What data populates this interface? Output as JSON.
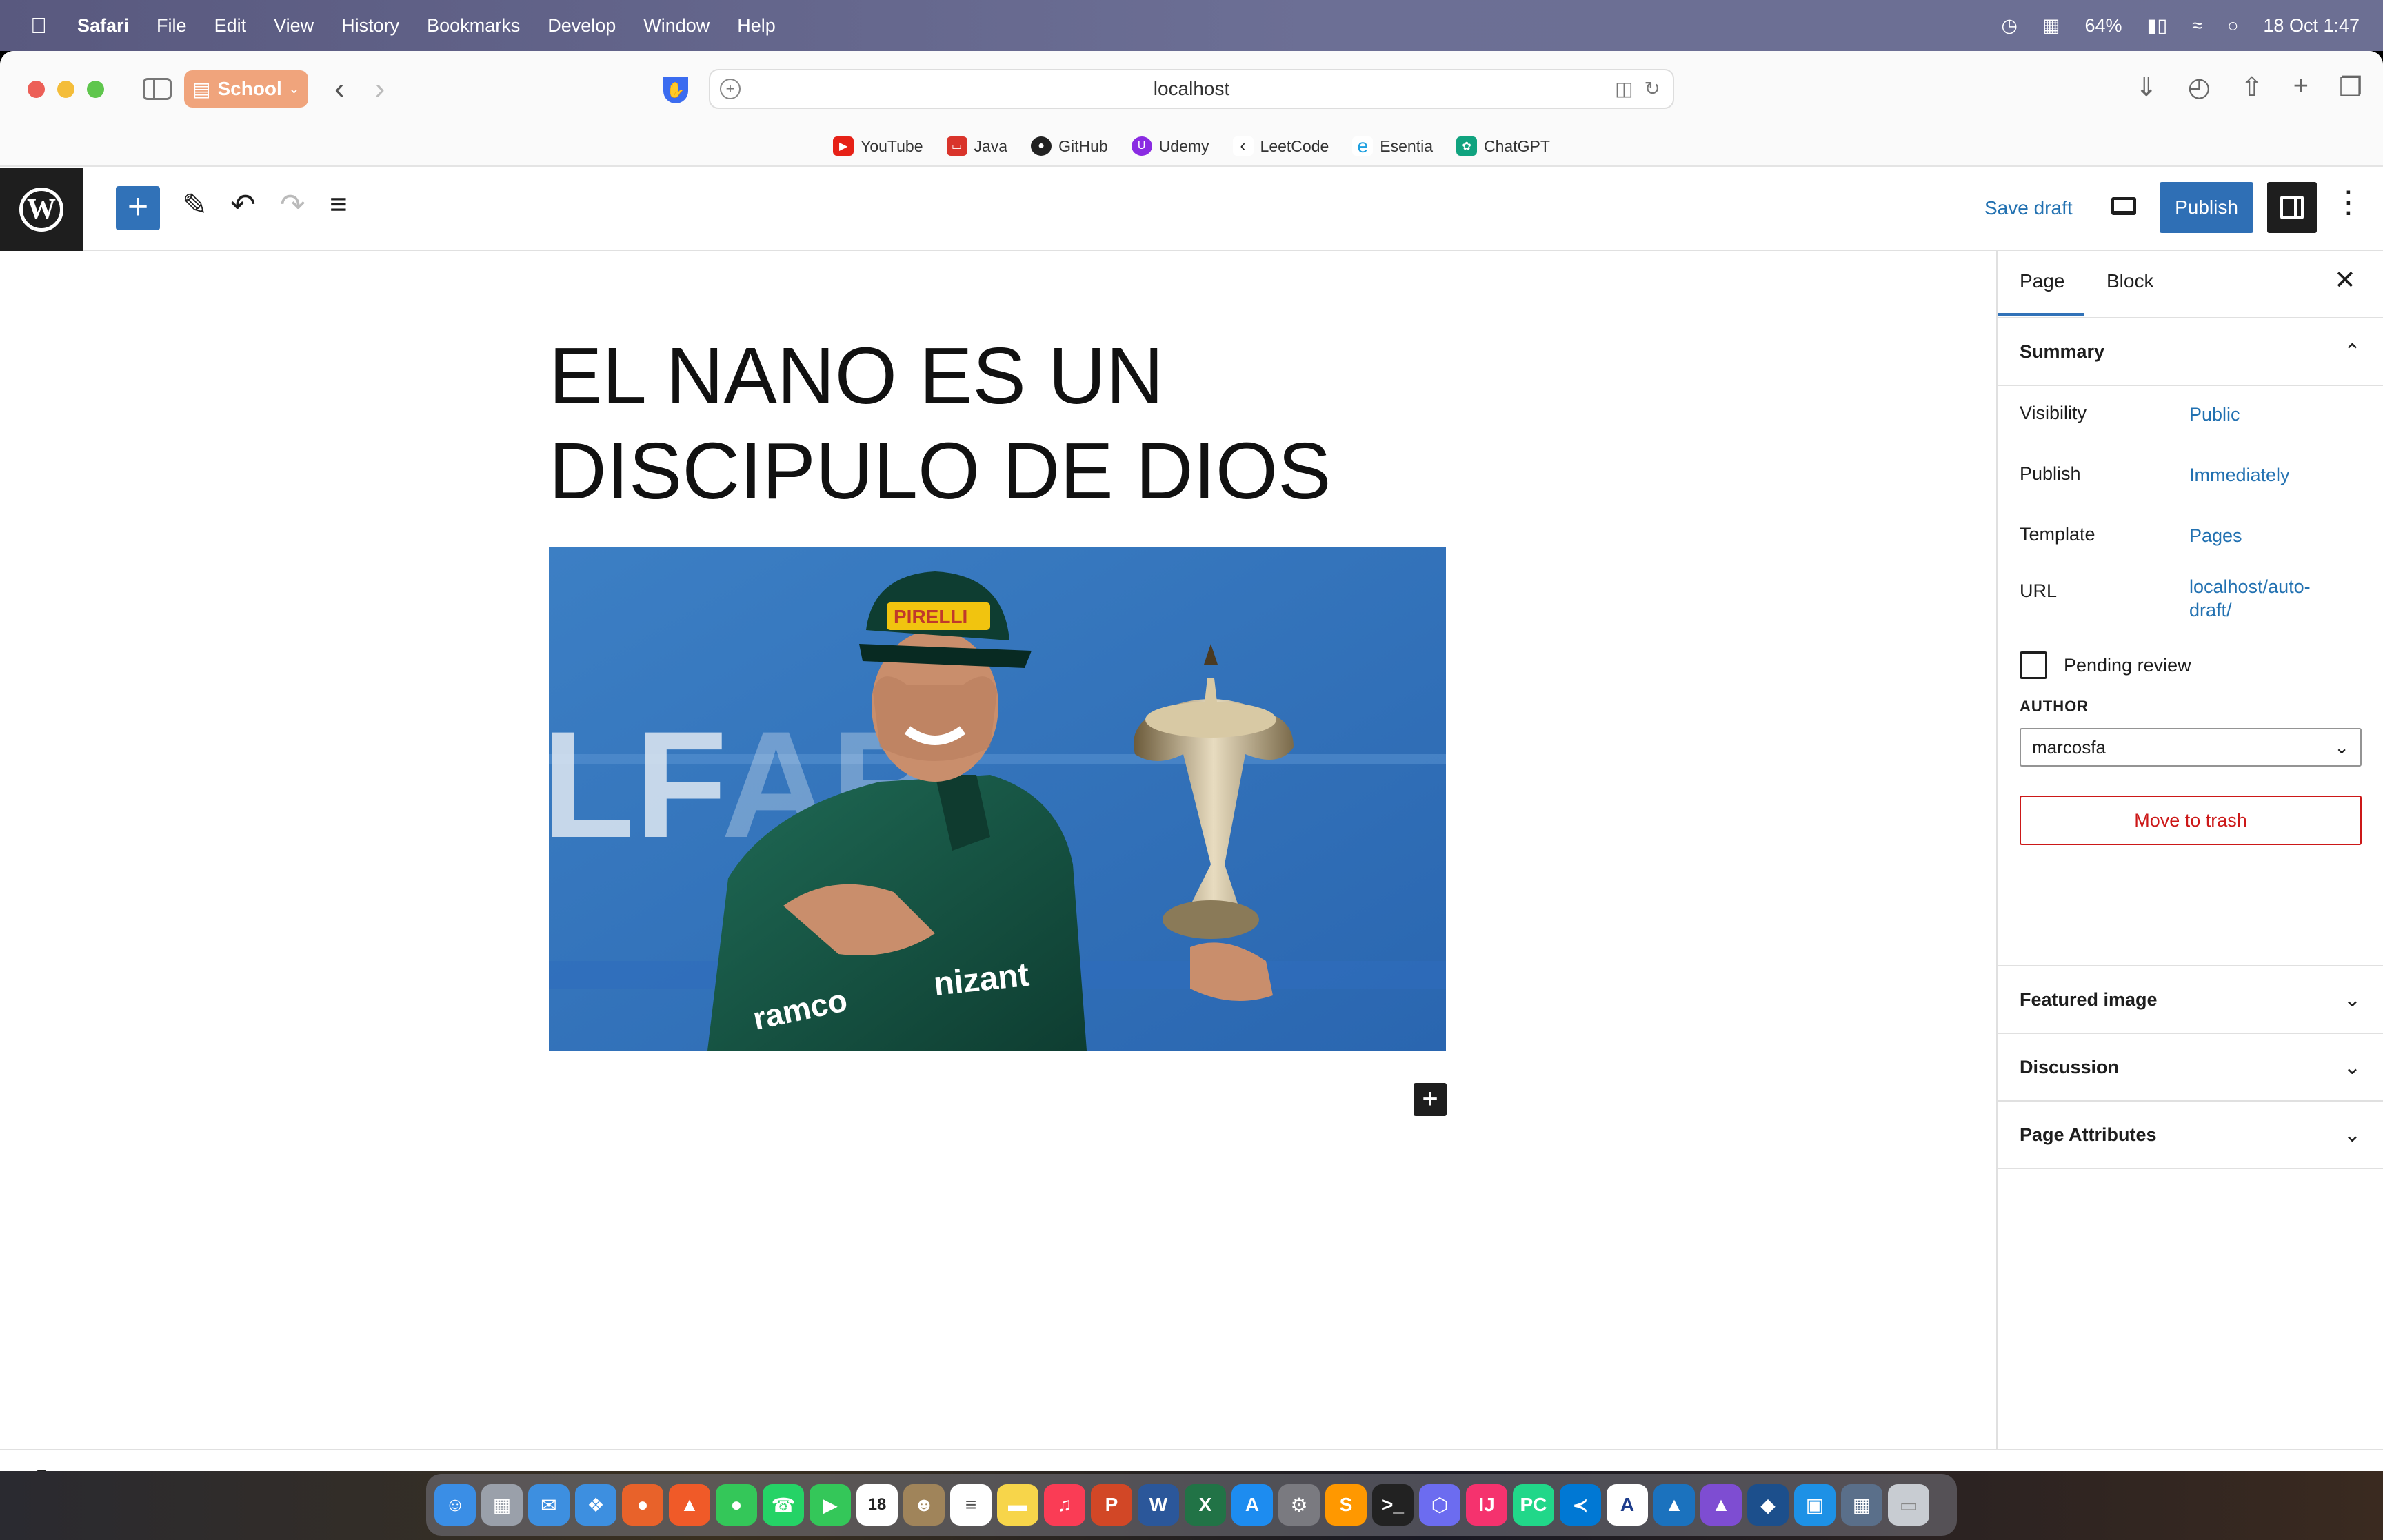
{
  "menubar": {
    "app": "Safari",
    "items": [
      "File",
      "Edit",
      "View",
      "History",
      "Bookmarks",
      "Develop",
      "Window",
      "Help"
    ],
    "battery": "64%",
    "datetime": "18 Oct  1:47"
  },
  "browser": {
    "tab_group": "School",
    "url": "localhost",
    "favorites": [
      {
        "label": "YouTube",
        "icon": "youtube-icon",
        "color": "#e62117"
      },
      {
        "label": "Java",
        "icon": "java-icon",
        "color": "#d9342b"
      },
      {
        "label": "GitHub",
        "icon": "github-icon",
        "color": "#222222"
      },
      {
        "label": "Udemy",
        "icon": "udemy-icon",
        "color": "#8a2be2"
      },
      {
        "label": "LeetCode",
        "icon": "leetcode-icon",
        "color": "#222222"
      },
      {
        "label": "Esentia",
        "icon": "esentia-icon",
        "color": "#1ea0e0"
      },
      {
        "label": "ChatGPT",
        "icon": "chatgpt-icon",
        "color": "#10a37f"
      }
    ]
  },
  "editor": {
    "save_draft": "Save draft",
    "publish": "Publish",
    "title_line1": "EL NANO ES UN",
    "title_line2": "DISCIPULO DE DIOS",
    "footer_breadcrumb": "Page"
  },
  "panel": {
    "tabs": [
      "Page",
      "Block"
    ],
    "summary": {
      "heading": "Summary",
      "rows": [
        {
          "key": "Visibility",
          "value": "Public"
        },
        {
          "key": "Publish",
          "value": "Immediately"
        },
        {
          "key": "Template",
          "value": "Pages"
        },
        {
          "key": "URL",
          "value": "localhost/auto-draft/"
        }
      ],
      "pending_review": "Pending review",
      "author_label": "AUTHOR",
      "author_value": "marcosfa",
      "trash": "Move to trash"
    },
    "sections": [
      "Featured image",
      "Discussion",
      "Page Attributes"
    ]
  },
  "colors": {
    "wp_blue": "#3172b8",
    "link": "#2271b1",
    "trash_red": "#cc1818"
  }
}
